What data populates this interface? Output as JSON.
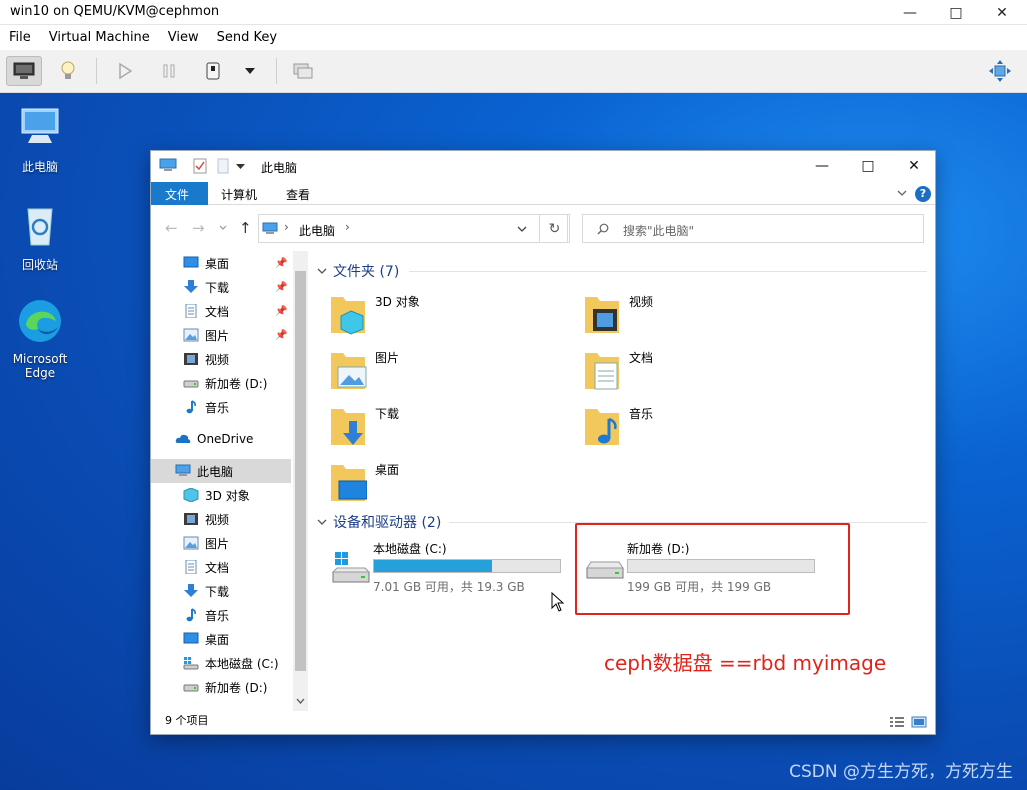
{
  "vm_window": {
    "title": "win10 on QEMU/KVM@cephmon",
    "menus": [
      "File",
      "Virtual Machine",
      "View",
      "Send Key"
    ]
  },
  "desktop": {
    "icons": [
      {
        "label": "此电脑"
      },
      {
        "label": "回收站"
      },
      {
        "label": "Microsoft Edge"
      }
    ],
    "watermark": "CSDN @方生方死，方死方生"
  },
  "explorer": {
    "title": "此电脑",
    "ribbon_tabs": [
      "文件",
      "计算机",
      "查看"
    ],
    "address": "此电脑",
    "search_placeholder": "搜索\"此电脑\"",
    "nav": {
      "quick": [
        {
          "label": "桌面"
        },
        {
          "label": "下载"
        },
        {
          "label": "文档"
        },
        {
          "label": "图片"
        },
        {
          "label": "视频"
        },
        {
          "label": "新加卷 (D:)"
        },
        {
          "label": "音乐"
        }
      ],
      "onedrive": "OneDrive",
      "thispc": "此电脑",
      "pc_children": [
        {
          "label": "3D 对象"
        },
        {
          "label": "视频"
        },
        {
          "label": "图片"
        },
        {
          "label": "文档"
        },
        {
          "label": "下载"
        },
        {
          "label": "音乐"
        },
        {
          "label": "桌面"
        },
        {
          "label": "本地磁盘 (C:)"
        },
        {
          "label": "新加卷 (D:)"
        }
      ]
    },
    "folders_header": "文件夹 (7)",
    "folders": [
      {
        "label": "3D 对象"
      },
      {
        "label": "视频"
      },
      {
        "label": "图片"
      },
      {
        "label": "文档"
      },
      {
        "label": "下载"
      },
      {
        "label": "音乐"
      },
      {
        "label": "桌面"
      }
    ],
    "devices_header": "设备和驱动器 (2)",
    "drives": [
      {
        "label": "本地磁盘 (C:)",
        "detail": "7.01 GB 可用，共 19.3 GB",
        "used_fraction": 0.637
      },
      {
        "label": "新加卷 (D:)",
        "detail": "199 GB 可用，共 199 GB",
        "used_fraction": 0.0
      }
    ],
    "status": "9 个项目"
  },
  "annotation": {
    "text": "ceph数据盘 ==rbd myimage",
    "color": "#e0241b"
  }
}
